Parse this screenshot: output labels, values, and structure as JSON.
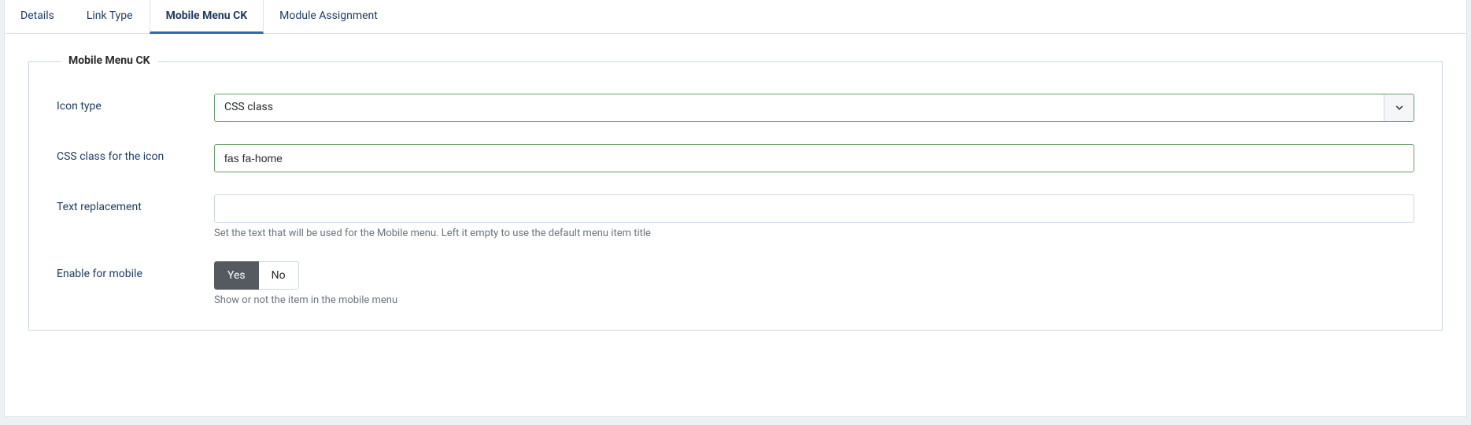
{
  "tabs": {
    "details": "Details",
    "link_type": "Link Type",
    "mobile_menu_ck": "Mobile Menu CK",
    "module_assignment": "Module Assignment"
  },
  "fieldset": {
    "legend": "Mobile Menu CK",
    "icon_type": {
      "label": "Icon type",
      "value": "CSS class"
    },
    "css_class": {
      "label": "CSS class for the icon",
      "value": "fas fa-home"
    },
    "text_replacement": {
      "label": "Text replacement",
      "value": "",
      "help": "Set the text that will be used for the Mobile menu. Left it empty to use the default menu item title"
    },
    "enable_mobile": {
      "label": "Enable for mobile",
      "yes": "Yes",
      "no": "No",
      "help": "Show or not the item in the mobile menu"
    }
  }
}
